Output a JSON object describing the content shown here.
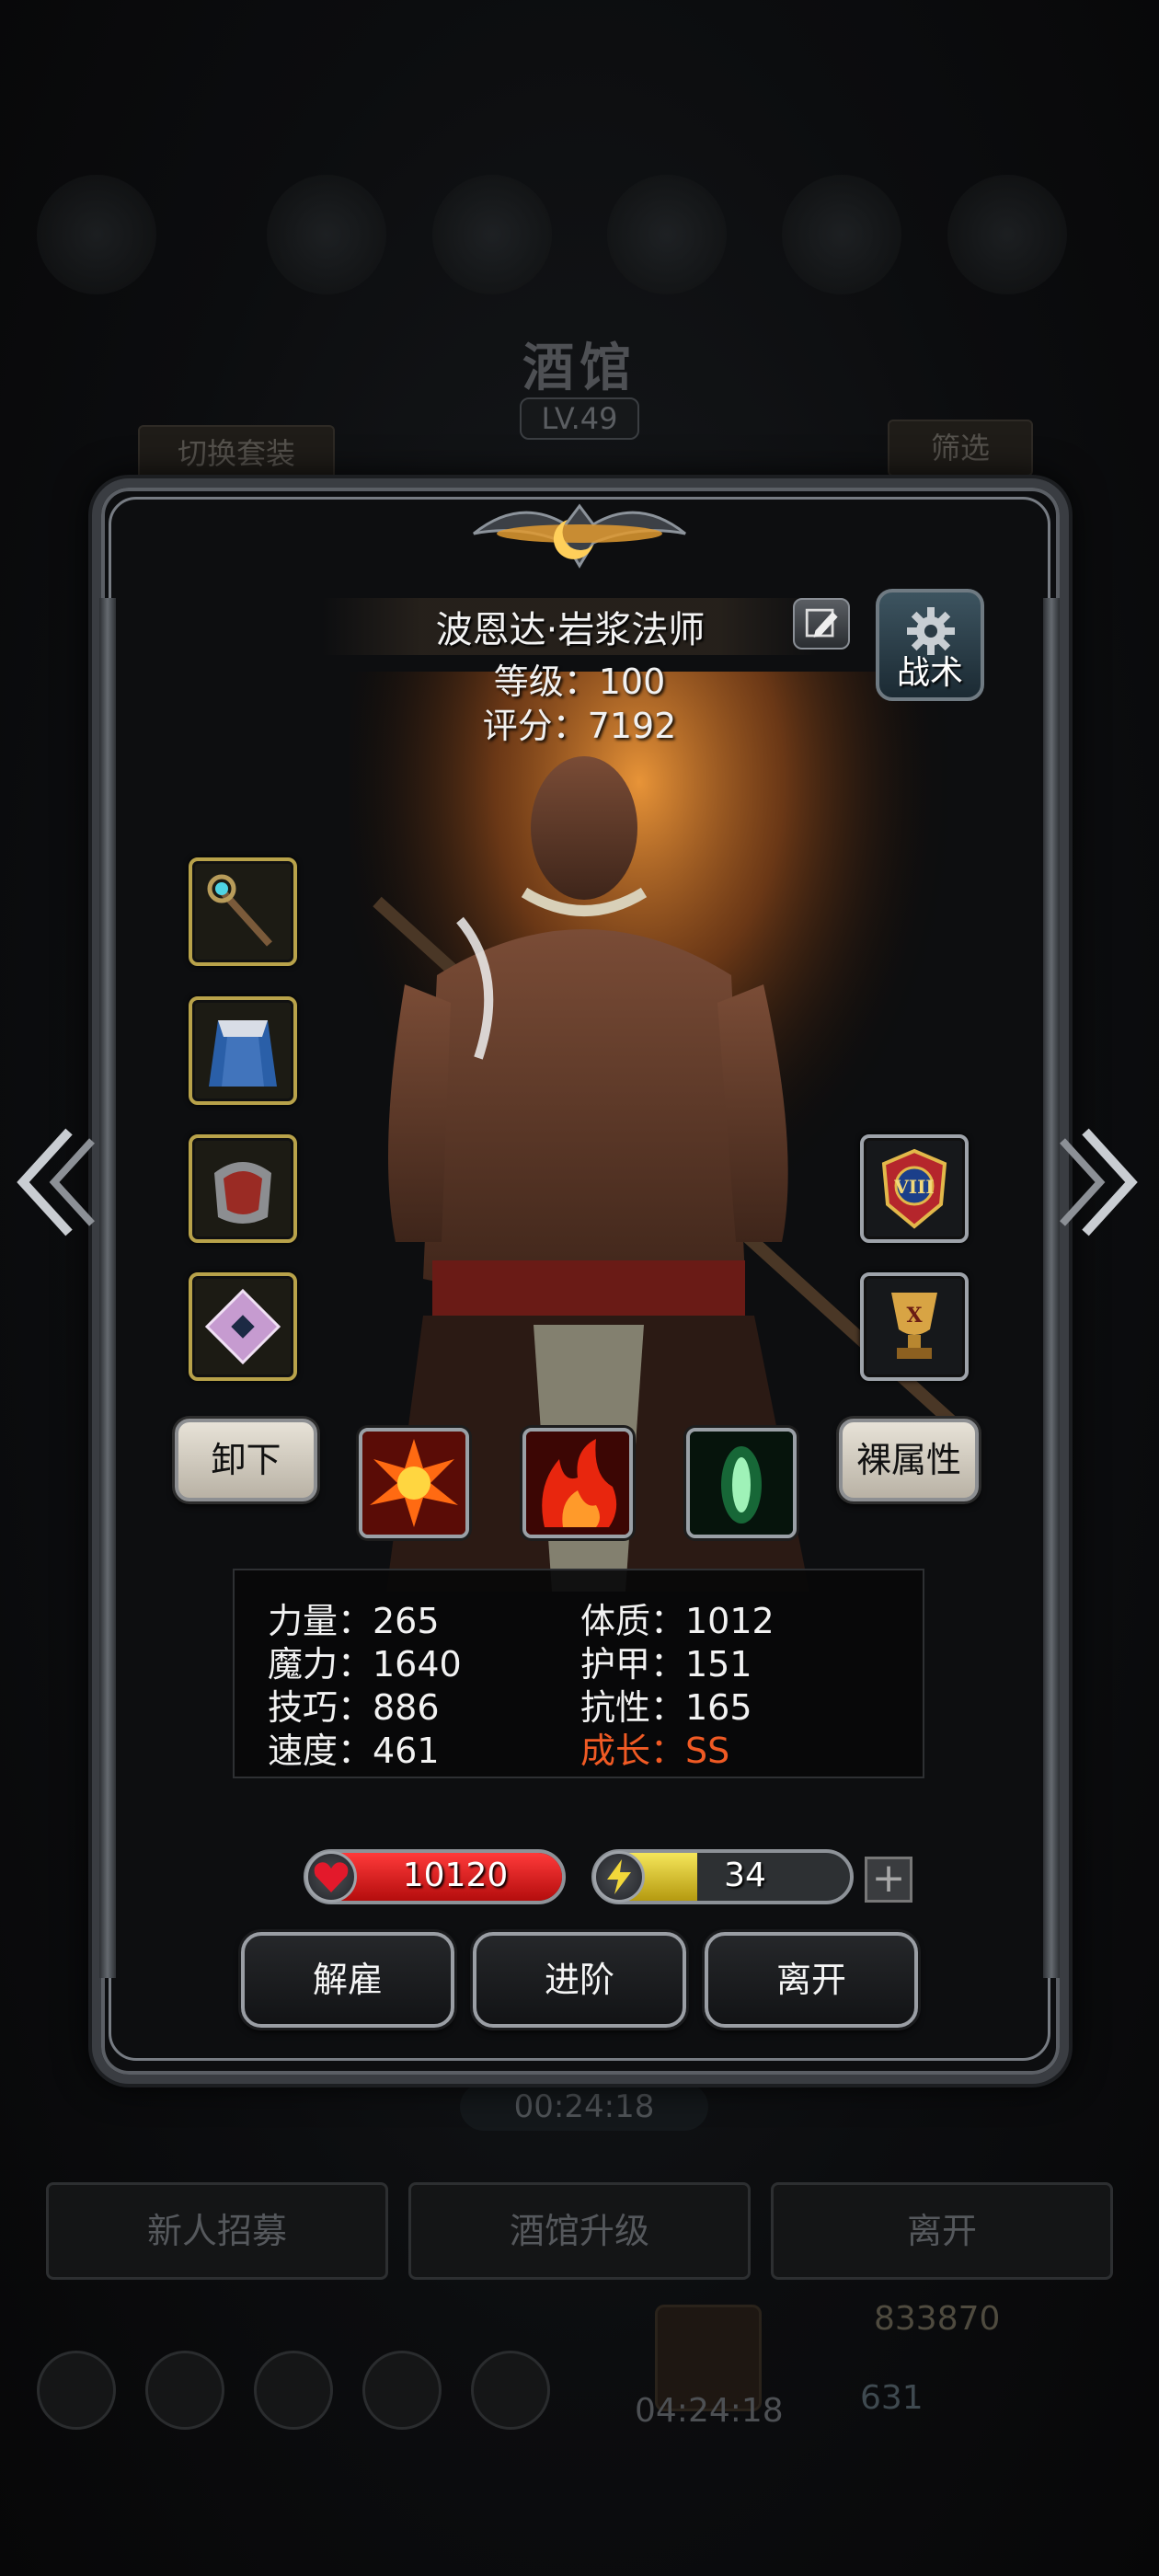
{
  "background": {
    "title": "酒馆",
    "level": "LV.49",
    "swap_outfit": "切换套装",
    "filter": "筛选",
    "timer_top": "00:24:18",
    "buttons": [
      "新人招募",
      "酒馆升级",
      "离开"
    ],
    "gold": "833870",
    "gems": "631",
    "timer_bottom": "04:24:18"
  },
  "hero": {
    "name": "波恩达·岩浆法师",
    "level_text": "等级：100",
    "score_text": "评分：7192"
  },
  "tactics": {
    "label": "战术",
    "icon": "gear-icon"
  },
  "equipment": [
    {
      "name": "staff",
      "icon": "staff-icon"
    },
    {
      "name": "cloak",
      "icon": "cloak-icon"
    },
    {
      "name": "bracer",
      "icon": "bracer-icon"
    },
    {
      "name": "rune",
      "icon": "rune-icon"
    }
  ],
  "badges": [
    {
      "name": "rank-badge",
      "text": "VIII"
    },
    {
      "name": "trophy-badge",
      "text": "X"
    }
  ],
  "actions": {
    "unequip": "卸下",
    "base_attributes": "裸属性"
  },
  "skills": [
    "fire-burst-icon",
    "flame-icon",
    "green-energy-icon"
  ],
  "stats": {
    "strength": "力量：265",
    "magic": "魔力：1640",
    "skill": "技巧：886",
    "speed": "速度：461",
    "constitution": "体质：1012",
    "armor": "护甲：151",
    "resistance": "抗性：165",
    "growth": "成长：SS"
  },
  "bars": {
    "hp": "10120",
    "energy": "34",
    "energy_fill_fraction": 0.4,
    "plus": "+"
  },
  "buttons": {
    "dismiss": "解雇",
    "advance": "进阶",
    "leave": "离开"
  },
  "colors": {
    "growth": "#f05a24",
    "hp": "#d81b1b",
    "energy": "#e9d43a",
    "slot_gold": "#b8a24a"
  }
}
